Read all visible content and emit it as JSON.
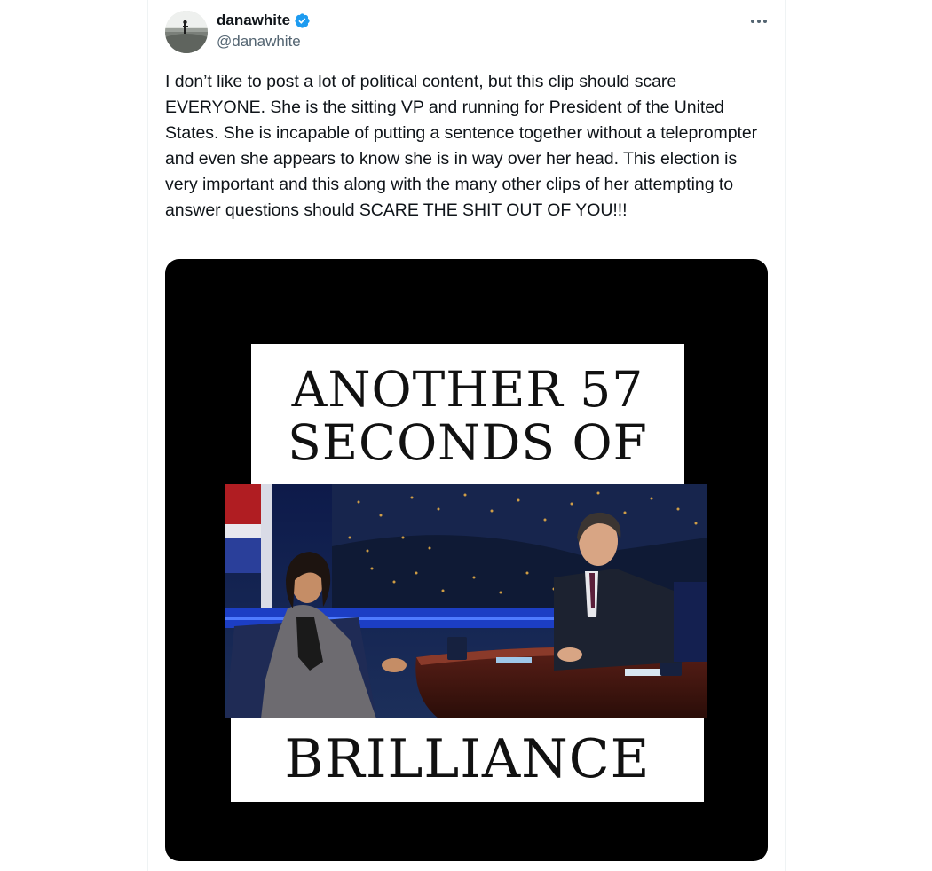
{
  "tweet": {
    "display_name": "danawhite",
    "handle": "@danawhite",
    "verified": true,
    "more_icon": "more-horizontal-icon",
    "text": "I don’t like to post a lot of political content, but this clip should scare EVERYONE. She is the sitting VP and running for President of the United States. She is incapable of putting a sentence together without a teleprompter and even she appears to know she is in way over her head. This election is very important and this along with the many other clips of her attempting to answer questions should SCARE THE SHIT OUT OF YOU!!!"
  },
  "media": {
    "caption_top_line1": "ANOTHER 57",
    "caption_top_line2": "SECONDS OF",
    "caption_bottom": "BRILLIANCE"
  },
  "colors": {
    "verified_badge": "#1d9bf0",
    "text_primary": "#0f1419",
    "text_secondary": "#536471",
    "media_bg": "#000000"
  }
}
